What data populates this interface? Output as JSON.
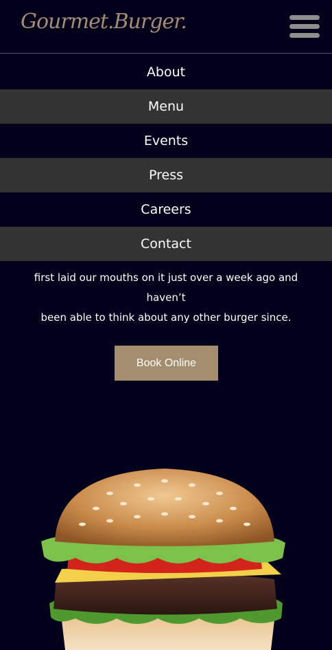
{
  "brand": {
    "logo_text": "Gourmet.Burger."
  },
  "header": {
    "menu_icon": "hamburger-menu-icon"
  },
  "nav": {
    "items": [
      {
        "label": "About"
      },
      {
        "label": "Menu"
      },
      {
        "label": "Events"
      },
      {
        "label": "Press"
      },
      {
        "label": "Careers"
      },
      {
        "label": "Contact"
      }
    ]
  },
  "intro": {
    "line1": "first laid our mouths on it just over a week ago and haven’t",
    "line2": "been able to think about any other burger since."
  },
  "cta": {
    "book_label": "Book Online"
  },
  "colors": {
    "background": "#02001a",
    "nav_alt": "#333333",
    "accent": "#a48c6e"
  }
}
